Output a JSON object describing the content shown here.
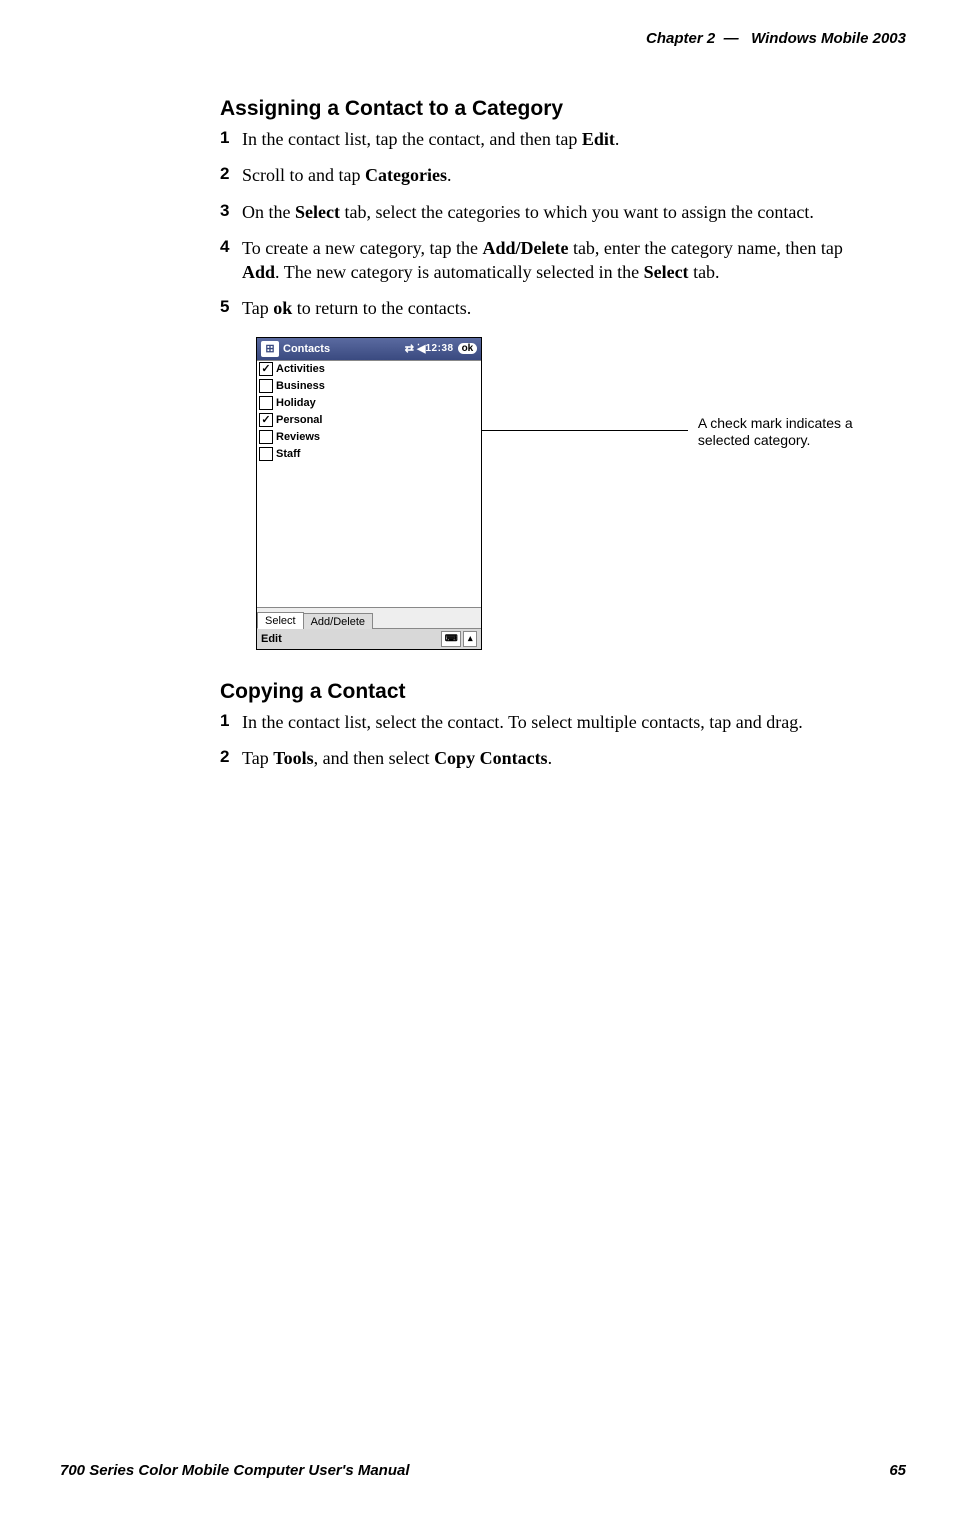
{
  "header": {
    "chapter_label": "Chapter",
    "chapter_number": "2",
    "separator": "—",
    "section_title": "Windows Mobile 2003"
  },
  "section1": {
    "title": "Assigning a Contact to a Category",
    "steps": [
      {
        "n": "1",
        "pre": "In the contact list, tap the contact, and then tap ",
        "b1": "Edit",
        "post": "."
      },
      {
        "n": "2",
        "pre": "Scroll to and tap ",
        "b1": "Categories",
        "post": "."
      },
      {
        "n": "3",
        "pre": "On the ",
        "b1": "Select",
        "mid": " tab, select the categories to which you want to assign the contact.",
        "post": ""
      },
      {
        "n": "4",
        "pre": "To create a new category, tap the ",
        "b1": "Add/Delete",
        "mid": " tab, enter the category name, then tap ",
        "b2": "Add",
        "mid2": ". The new category is automatically selected in the ",
        "b3": "Select",
        "post": " tab."
      },
      {
        "n": "5",
        "pre": "Tap ",
        "b1": "ok",
        "post": " to return to the contacts."
      }
    ]
  },
  "screenshot": {
    "app_title": "Contacts",
    "status_time": "12:38",
    "ok_label": "ok",
    "rows": [
      {
        "label": "Activities",
        "checked": true
      },
      {
        "label": "Business",
        "checked": false
      },
      {
        "label": "Holiday",
        "checked": false
      },
      {
        "label": "Personal",
        "checked": true
      },
      {
        "label": "Reviews",
        "checked": false
      },
      {
        "label": "Staff",
        "checked": false
      }
    ],
    "tabs": {
      "select": "Select",
      "add_delete": "Add/Delete"
    },
    "bottom": {
      "edit": "Edit",
      "kbd": "⌨",
      "caret": "▴"
    },
    "callout": "A check mark indicates a selected category."
  },
  "section2": {
    "title": "Copying a Contact",
    "steps": [
      {
        "n": "1",
        "pre": "In the contact list, select the contact. To select multiple contacts, tap and drag."
      },
      {
        "n": "2",
        "pre": "Tap ",
        "b1": "Tools",
        "mid": ", and then select ",
        "b2": "Copy Contacts",
        "post": "."
      }
    ]
  },
  "footer": {
    "manual_title": "700 Series Color Mobile Computer User's Manual",
    "page_number": "65"
  }
}
